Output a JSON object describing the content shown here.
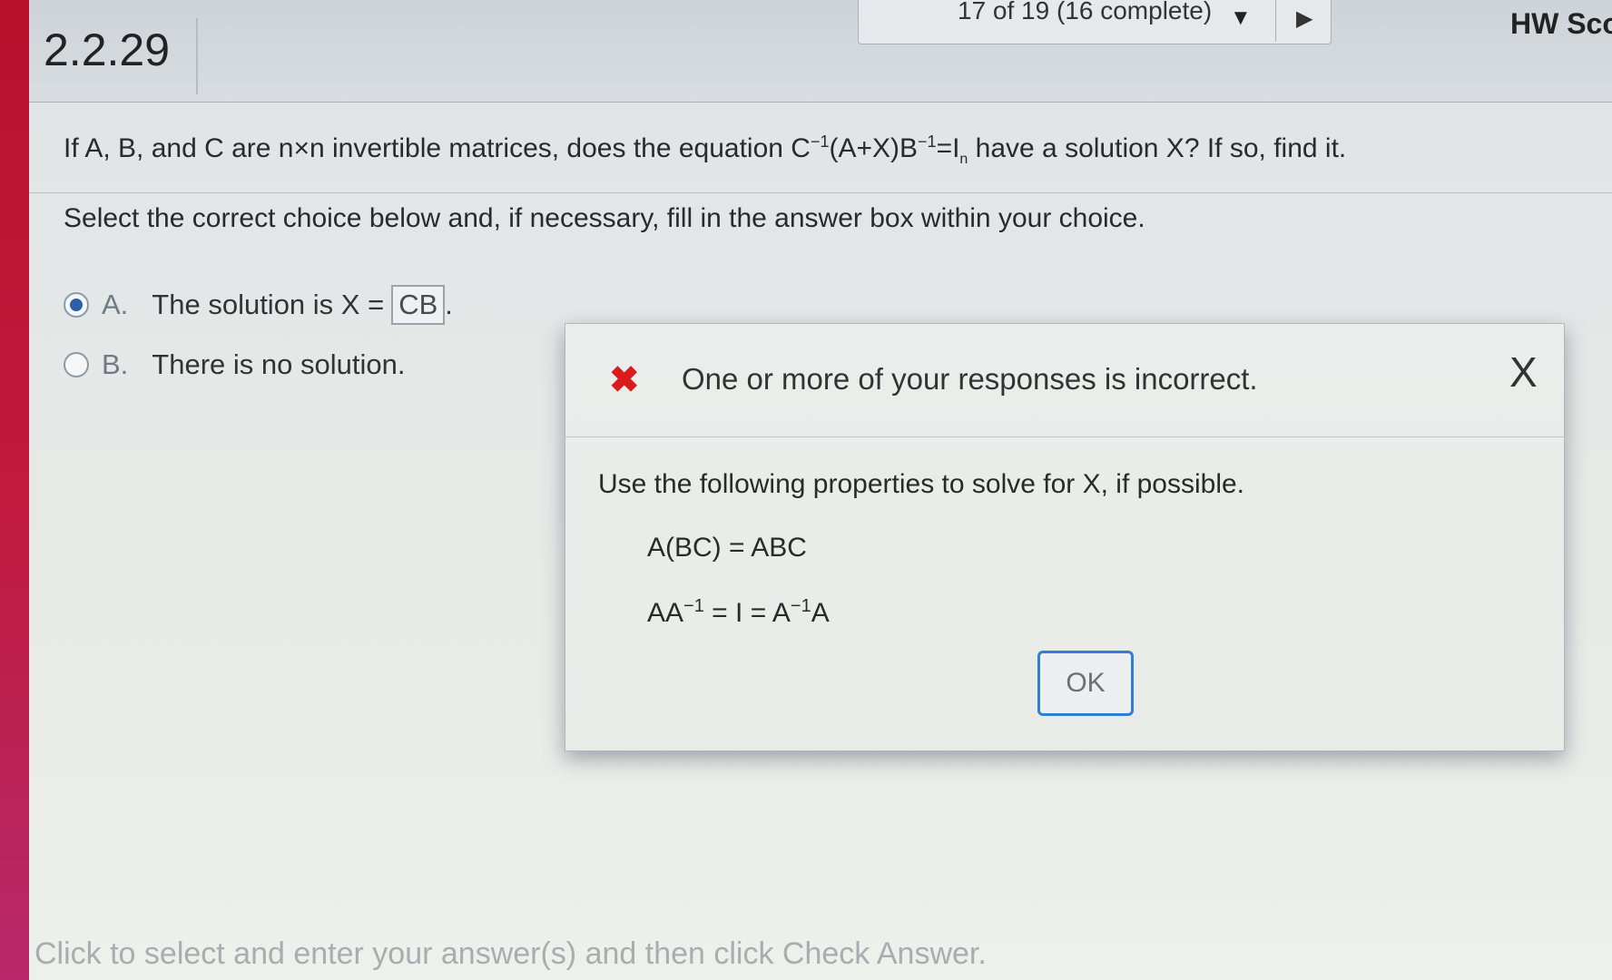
{
  "header": {
    "question_number": "2.2.29",
    "progress_text": "17 of 19 (16 complete)",
    "hw_score_label": "HW Sco"
  },
  "question": {
    "text_pre": "If A, B, and C are n×n invertible matrices, does the equation C",
    "text_sup1": "−1",
    "text_mid": "(A+X)B",
    "text_sup2": "−1",
    "text_eq": "=I",
    "text_sub": "n",
    "text_post": " have a solution X? If so, find it.",
    "instruction": "Select the correct choice below and, if necessary, fill in the answer box within your choice."
  },
  "choices": [
    {
      "letter": "A.",
      "text": "The solution is X =",
      "answer": "CB",
      "trailing": ".",
      "selected": true
    },
    {
      "letter": "B.",
      "text": "There is no solution.",
      "selected": false
    }
  ],
  "footer": {
    "instruction": "Click to select and enter your answer(s) and then click Check Answer."
  },
  "modal": {
    "icon": "error-x-icon",
    "title": "One or more of your responses is incorrect.",
    "close_label": "X",
    "hint": "Use the following properties to solve for X, if possible.",
    "property1": "A(BC) = ABC",
    "property2_a": "AA",
    "property2_sup1": "−1",
    "property2_b": " = I = A",
    "property2_sup2": "−1",
    "property2_c": "A",
    "ok_label": "OK"
  },
  "colors": {
    "accent_bar": "#b8112c",
    "ok_border": "#2f7fd1",
    "error": "#d81b1b",
    "radio_selected": "#2f5fa8"
  }
}
